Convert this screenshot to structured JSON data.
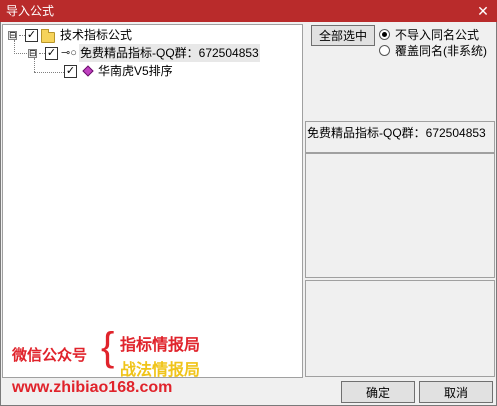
{
  "window": {
    "title": "导入公式",
    "close_glyph": "✕",
    "title_bar_color": "#b92b2b"
  },
  "tree": {
    "root": {
      "label": "技术指标公式",
      "expander": "⊟",
      "checked": true,
      "icon": "folder-icon"
    },
    "group": {
      "label": "免费精品指标-QQ群：672504853",
      "expander": "⊟",
      "checked": true,
      "icon": "key-icon"
    },
    "item": {
      "label": "华南虎V5排序",
      "checked": true,
      "icon": "diamond-icon"
    },
    "check_glyph": "✓"
  },
  "controls": {
    "select_all_label": "全部选中",
    "radio_options": [
      {
        "label": "不导入同名公式",
        "checked": true
      },
      {
        "label": "覆盖同名(非系统)",
        "checked": false
      }
    ]
  },
  "info": {
    "selected_name": "免费精品指标-QQ群：672504853"
  },
  "promo": {
    "wechat_label": "微信公众号",
    "brace": "{",
    "line1": "指标情报局",
    "line2": "战法情报局",
    "url": "www.zhibiao168.com",
    "red_color": "#e0232b",
    "yellow_color": "#f0c419"
  },
  "buttons": {
    "ok_label": "确定",
    "cancel_label": "取消"
  }
}
